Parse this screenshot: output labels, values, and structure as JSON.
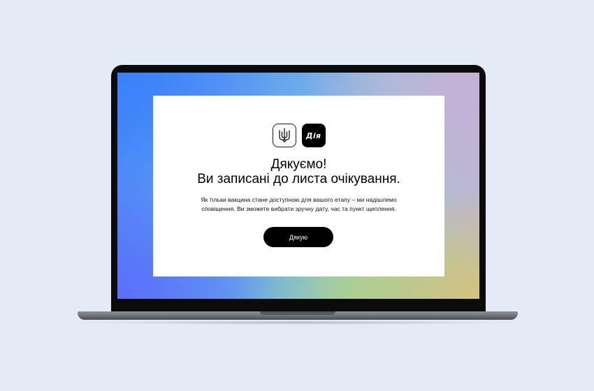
{
  "logos": {
    "trident": "trident-emblem",
    "diia_label": "Дія"
  },
  "heading": {
    "line1": "Дякуємо!",
    "line2": "Ви записані до листа очікування."
  },
  "description": {
    "line1": "Як тільки вакцина стане доступною для вашого етапу – ми надішлемо",
    "line2": "сповіщення. Ви зможете вибрати зручну дату, час та пункт щеплення."
  },
  "button": {
    "label": "Дякую"
  },
  "colors": {
    "page_background": "#e3ecf6",
    "button_background": "#000000",
    "panel_background": "#ffffff"
  }
}
